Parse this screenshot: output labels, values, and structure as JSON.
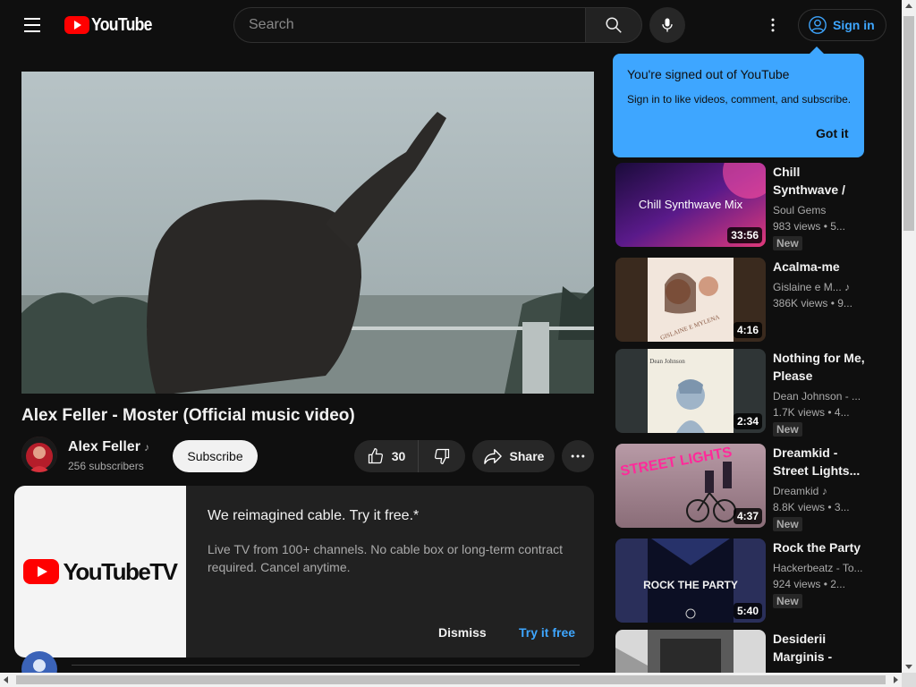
{
  "header": {
    "logo_text": "YouTube",
    "search_placeholder": "Search",
    "signin_label": "Sign in"
  },
  "video": {
    "title": "Alex Feller - Moster (Official music video)",
    "channel_name": "Alex Feller",
    "subscribers": "256 subscribers",
    "subscribe_label": "Subscribe",
    "likes": "30",
    "share_label": "Share"
  },
  "ad": {
    "logo_text": "YouTubeTV",
    "headline": "We reimagined cable. Try it free.*",
    "body": "Live TV from 100+ channels. No cable box or long-term contract required. Cancel anytime.",
    "dismiss_label": "Dismiss",
    "try_label": "Try it free"
  },
  "popup": {
    "title": "You're signed out of YouTube",
    "body": "Sign in to like videos, comment, and subscribe.",
    "button": "Got it"
  },
  "recommendations": [
    {
      "title": "Chill Synthwave / Electronic M...",
      "channel": "Soul Gems",
      "meta": "983 views  •  5...",
      "badge": "New",
      "duration": "33:56",
      "thumb_text": "Chill Synthwave Mix",
      "music": false
    },
    {
      "title": "Acalma-me",
      "channel": "Gislaine e M...",
      "meta": "386K views  •  9...",
      "badge": "",
      "duration": "4:16",
      "thumb_text": "GISLAINE E MYLENA",
      "music": true
    },
    {
      "title": "Nothing for Me, Please",
      "channel": "Dean Johnson - ...",
      "meta": "1.7K views  •  4...",
      "badge": "New",
      "duration": "2:34",
      "thumb_text": "Dean Johnson",
      "music": false
    },
    {
      "title": "Dreamkid - Street Lights...",
      "channel": "Dreamkid",
      "meta": "8.8K views  •  3...",
      "badge": "New",
      "duration": "4:37",
      "thumb_text": "STREET LIGHTS",
      "music": true
    },
    {
      "title": "Rock the Party",
      "channel": "Hackerbeatz - To...",
      "meta": "924 views  •  2...",
      "badge": "New",
      "duration": "5:40",
      "thumb_text": "ROCK THE PARTY",
      "music": false
    },
    {
      "title": "Desiderii Marginis - The...",
      "channel": "",
      "meta": "",
      "badge": "",
      "duration": "",
      "thumb_text": "",
      "music": false
    }
  ],
  "colors": {
    "background": "#0f0f0f",
    "accent_blue": "#3ea6ff",
    "youtube_red": "#ff0000"
  }
}
